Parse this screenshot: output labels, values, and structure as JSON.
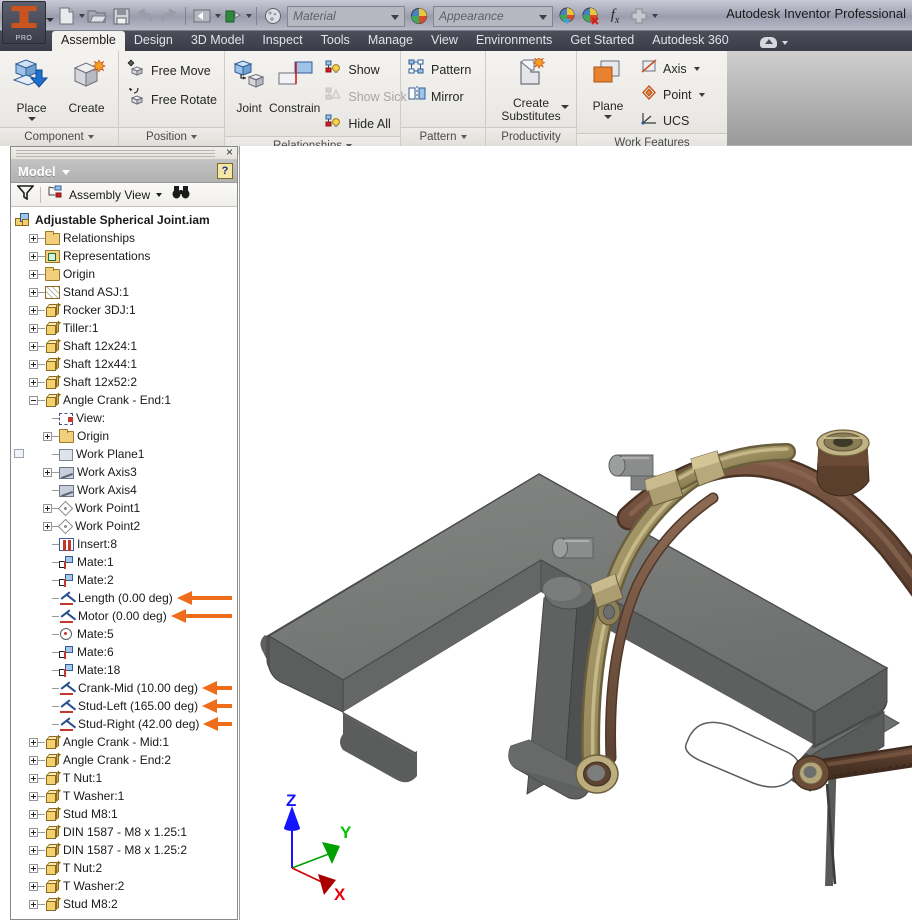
{
  "window": {
    "title": "Autodesk Inventor Professional",
    "app_logo_label": "PRO"
  },
  "quick_access": {
    "items": [
      {
        "name": "new-file-button",
        "icon": "new-file-icon",
        "has_caret": true
      },
      {
        "name": "open-file-button",
        "icon": "open-folder-icon",
        "has_caret": false
      },
      {
        "name": "save-button",
        "icon": "save-disk-icon",
        "has_caret": false
      },
      {
        "name": "undo-button",
        "icon": "undo-arrow-icon",
        "has_caret": false
      },
      {
        "name": "redo-button",
        "icon": "redo-arrow-icon",
        "has_caret": false
      },
      {
        "name": "return-button",
        "icon": "return-icon",
        "has_caret": true
      },
      {
        "name": "update-button",
        "icon": "update-icon",
        "has_caret": true
      },
      {
        "name": "select-button",
        "icon": "select-sphere-icon",
        "has_caret": false
      }
    ],
    "material_placeholder": "Material",
    "appearance_placeholder": "Appearance",
    "trailing": [
      {
        "name": "adjust-appearance-button",
        "icon": "appearance-adjust-icon"
      },
      {
        "name": "clear-appearance-button",
        "icon": "appearance-clear-icon"
      },
      {
        "name": "parameters-button",
        "icon": "fx-icon",
        "label": "fx"
      },
      {
        "name": "customize-qat-button",
        "icon": "plus-icon"
      },
      {
        "name": "qat-overflow-button",
        "icon": "chevron-down-icon"
      }
    ]
  },
  "ribbon": {
    "tabs": [
      {
        "label": "Assemble",
        "active": true
      },
      {
        "label": "Design",
        "active": false
      },
      {
        "label": "3D Model",
        "active": false
      },
      {
        "label": "Inspect",
        "active": false
      },
      {
        "label": "Tools",
        "active": false
      },
      {
        "label": "Manage",
        "active": false
      },
      {
        "label": "View",
        "active": false
      },
      {
        "label": "Environments",
        "active": false
      },
      {
        "label": "Get Started",
        "active": false
      },
      {
        "label": "Autodesk 360",
        "active": false
      }
    ],
    "panels": [
      {
        "label": "Component",
        "has_caret": true,
        "big_buttons": [
          {
            "label": "Place",
            "icon": "place-component-icon",
            "has_caret": true
          },
          {
            "label": "Create",
            "icon": "create-component-icon",
            "has_caret": false
          }
        ],
        "small_buttons": []
      },
      {
        "label": "Position",
        "has_caret": true,
        "big_buttons": [],
        "small_buttons": [
          {
            "label": "Free Move",
            "icon": "free-move-icon",
            "disabled": false,
            "has_caret": false
          },
          {
            "label": "Free Rotate",
            "icon": "free-rotate-icon",
            "disabled": false,
            "has_caret": false
          }
        ]
      },
      {
        "label": "Relationships",
        "has_caret": true,
        "big_buttons": [
          {
            "label": "Joint",
            "icon": "joint-icon",
            "has_caret": false
          },
          {
            "label": "Constrain",
            "icon": "constrain-icon",
            "has_caret": false
          }
        ],
        "small_buttons": [
          {
            "label": "Show",
            "icon": "show-relationships-icon",
            "disabled": false,
            "has_caret": false
          },
          {
            "label": "Show Sick",
            "icon": "show-sick-icon",
            "disabled": true,
            "has_caret": false
          },
          {
            "label": "Hide All",
            "icon": "hide-all-icon",
            "disabled": false,
            "has_caret": false
          }
        ]
      },
      {
        "label": "Pattern",
        "has_caret": true,
        "big_buttons": [],
        "small_buttons": [
          {
            "label": "Pattern",
            "icon": "pattern-icon",
            "disabled": false,
            "has_caret": false
          },
          {
            "label": "Mirror",
            "icon": "mirror-icon",
            "disabled": false,
            "has_caret": false
          }
        ]
      },
      {
        "label": "Productivity",
        "has_caret": false,
        "big_buttons": [
          {
            "label": "Create Substitutes",
            "icon": "create-substitutes-icon",
            "has_caret": true
          }
        ],
        "small_buttons": []
      },
      {
        "label": "Work Features",
        "has_caret": false,
        "big_buttons": [
          {
            "label": "Plane",
            "icon": "work-plane-icon",
            "has_caret": true
          }
        ],
        "small_buttons": [
          {
            "label": "Axis",
            "icon": "work-axis-icon",
            "disabled": false,
            "has_caret": true
          },
          {
            "label": "Point",
            "icon": "work-point-icon",
            "disabled": false,
            "has_caret": true
          },
          {
            "label": "UCS",
            "icon": "ucs-icon",
            "disabled": false,
            "has_caret": false
          }
        ]
      }
    ]
  },
  "browser": {
    "panel_title": "Model",
    "close_label": "×",
    "help_label": "?",
    "toolbar": {
      "filter_icon": "filter-funnel-icon",
      "view_mode": "Assembly View",
      "view_mode_caret": true,
      "find_icon": "binoculars-icon"
    },
    "tree": [
      {
        "label": "Adjustable Spherical Joint.iam",
        "indent": 0,
        "icon": "assembly-icon",
        "expander": "none",
        "root": true,
        "arrow": false
      },
      {
        "label": "Relationships",
        "indent": 1,
        "icon": "folder-icon",
        "expander": "plus",
        "root": false,
        "arrow": false
      },
      {
        "label": "Representations",
        "indent": 1,
        "icon": "representations-icon",
        "expander": "plus",
        "root": false,
        "arrow": false
      },
      {
        "label": "Origin",
        "indent": 1,
        "icon": "folder-icon",
        "expander": "plus",
        "root": false,
        "arrow": false
      },
      {
        "label": "Stand ASJ:1",
        "indent": 1,
        "icon": "stand-part-icon",
        "expander": "plus",
        "root": false,
        "arrow": false
      },
      {
        "label": "Rocker 3DJ:1",
        "indent": 1,
        "icon": "part-icon",
        "expander": "plus",
        "root": false,
        "arrow": false
      },
      {
        "label": "Tiller:1",
        "indent": 1,
        "icon": "part-icon",
        "expander": "plus",
        "root": false,
        "arrow": false
      },
      {
        "label": "Shaft 12x24:1",
        "indent": 1,
        "icon": "part-icon",
        "expander": "plus",
        "root": false,
        "arrow": false
      },
      {
        "label": "Shaft 12x44:1",
        "indent": 1,
        "icon": "part-icon",
        "expander": "plus",
        "root": false,
        "arrow": false
      },
      {
        "label": "Shaft 12x52:2",
        "indent": 1,
        "icon": "part-icon",
        "expander": "plus",
        "root": false,
        "arrow": false
      },
      {
        "label": "Angle Crank - End:1",
        "indent": 1,
        "icon": "part-icon",
        "expander": "minus",
        "root": false,
        "arrow": false
      },
      {
        "label": "View:",
        "indent": 2,
        "icon": "view-icon",
        "expander": "none",
        "root": false,
        "arrow": false
      },
      {
        "label": "Origin",
        "indent": 2,
        "icon": "folder-icon",
        "expander": "plus",
        "root": false,
        "arrow": false
      },
      {
        "label": "Work Plane1",
        "indent": 2,
        "icon": "work-plane-icon",
        "expander": "none",
        "root": false,
        "arrow": false
      },
      {
        "label": "Work Axis3",
        "indent": 2,
        "icon": "work-axis-icon",
        "expander": "plus",
        "root": false,
        "arrow": false
      },
      {
        "label": "Work Axis4",
        "indent": 2,
        "icon": "work-axis-icon",
        "expander": "none",
        "root": false,
        "arrow": false
      },
      {
        "label": "Work Point1",
        "indent": 2,
        "icon": "work-point-icon",
        "expander": "plus",
        "root": false,
        "arrow": false
      },
      {
        "label": "Work Point2",
        "indent": 2,
        "icon": "work-point-icon",
        "expander": "plus",
        "root": false,
        "arrow": false
      },
      {
        "label": "Insert:8",
        "indent": 2,
        "icon": "insert-constraint-icon",
        "expander": "none",
        "root": false,
        "arrow": false
      },
      {
        "label": "Mate:1",
        "indent": 2,
        "icon": "mate-constraint-icon",
        "expander": "none",
        "root": false,
        "arrow": false
      },
      {
        "label": "Mate:2",
        "indent": 2,
        "icon": "mate-constraint-icon",
        "expander": "none",
        "root": false,
        "arrow": false
      },
      {
        "label": "Length (0.00 deg)",
        "indent": 2,
        "icon": "angle-constraint-icon",
        "expander": "none",
        "root": false,
        "arrow": true
      },
      {
        "label": "Motor (0.00 deg)",
        "indent": 2,
        "icon": "angle-constraint-icon",
        "expander": "none",
        "root": false,
        "arrow": true
      },
      {
        "label": "Mate:5",
        "indent": 2,
        "icon": "circular-constraint-icon",
        "expander": "none",
        "root": false,
        "arrow": false
      },
      {
        "label": "Mate:6",
        "indent": 2,
        "icon": "mate-constraint-icon",
        "expander": "none",
        "root": false,
        "arrow": false
      },
      {
        "label": "Mate:18",
        "indent": 2,
        "icon": "mate-constraint-icon",
        "expander": "none",
        "root": false,
        "arrow": false
      },
      {
        "label": "Crank-Mid (10.00 deg)",
        "indent": 2,
        "icon": "angle-constraint-icon",
        "expander": "none",
        "root": false,
        "arrow": true
      },
      {
        "label": "Stud-Left (165.00 deg)",
        "indent": 2,
        "icon": "angle-constraint-icon",
        "expander": "none",
        "root": false,
        "arrow": true
      },
      {
        "label": "Stud-Right (42.00 deg)",
        "indent": 2,
        "icon": "angle-constraint-icon",
        "expander": "none",
        "root": false,
        "arrow": true
      },
      {
        "label": "Angle Crank - Mid:1",
        "indent": 1,
        "icon": "part-icon",
        "expander": "plus",
        "root": false,
        "arrow": false
      },
      {
        "label": "Angle Crank - End:2",
        "indent": 1,
        "icon": "part-icon",
        "expander": "plus",
        "root": false,
        "arrow": false
      },
      {
        "label": "T Nut:1",
        "indent": 1,
        "icon": "part-icon",
        "expander": "plus",
        "root": false,
        "arrow": false
      },
      {
        "label": "T Washer:1",
        "indent": 1,
        "icon": "part-icon",
        "expander": "plus",
        "root": false,
        "arrow": false
      },
      {
        "label": "Stud M8:1",
        "indent": 1,
        "icon": "part-icon",
        "expander": "plus",
        "root": false,
        "arrow": false
      },
      {
        "label": "DIN 1587 - M8 x 1.25:1",
        "indent": 1,
        "icon": "part-icon",
        "expander": "plus",
        "root": false,
        "arrow": false
      },
      {
        "label": "DIN 1587 - M8 x 1.25:2",
        "indent": 1,
        "icon": "part-icon",
        "expander": "plus",
        "root": false,
        "arrow": false
      },
      {
        "label": "T Nut:2",
        "indent": 1,
        "icon": "part-icon",
        "expander": "plus",
        "root": false,
        "arrow": false
      },
      {
        "label": "T Washer:2",
        "indent": 1,
        "icon": "part-icon",
        "expander": "plus",
        "root": false,
        "arrow": false
      },
      {
        "label": "Stud M8:2",
        "indent": 1,
        "icon": "part-icon",
        "expander": "plus",
        "root": false,
        "arrow": false
      }
    ]
  },
  "viewport": {
    "background": "#ffffff",
    "model_name": "Adjustable Spherical Joint",
    "triad": {
      "x_label": "X",
      "x_color": "#e8000d",
      "y_label": "Y",
      "y_color": "#00c200",
      "z_label": "Z",
      "z_color": "#1414ff"
    },
    "colors": {
      "steel_gray": "#6e7070",
      "brass": "#9a8d5c",
      "bronze": "#6b4a3a",
      "annotation_orange": "#ef6c1a"
    }
  }
}
